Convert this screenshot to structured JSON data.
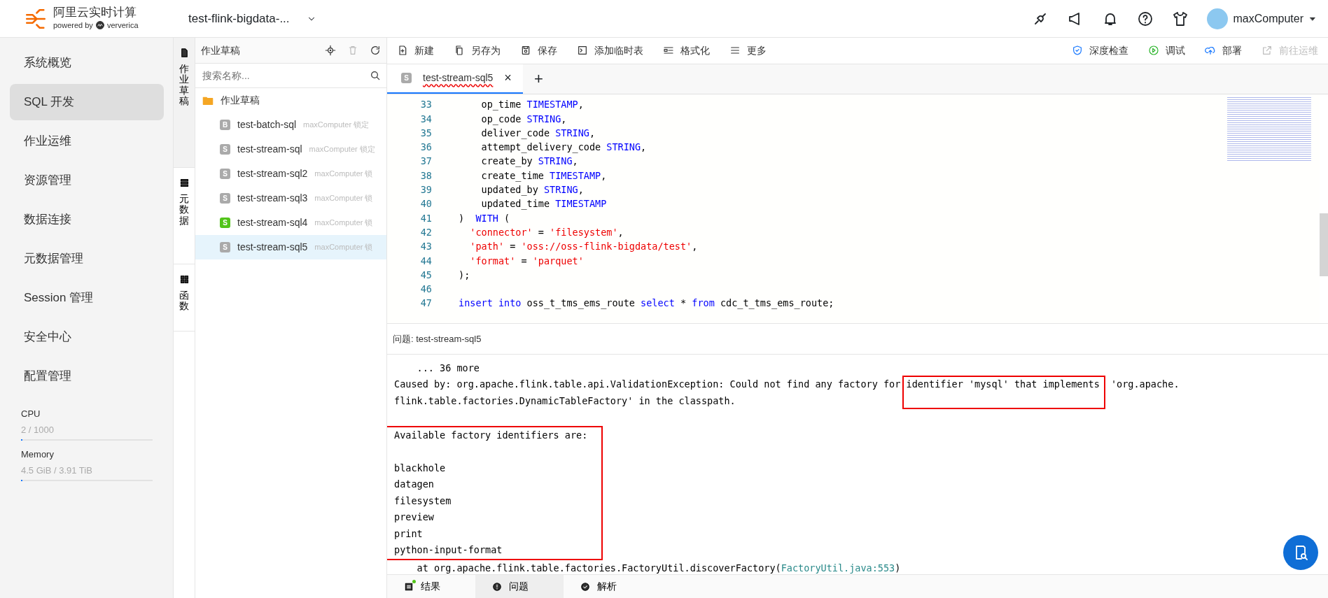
{
  "header": {
    "brand": "阿里云实时计算",
    "powered_by": "powered by",
    "partner": "ververica",
    "workspace": "test-flink-bigdata-...",
    "user": "maxComputer"
  },
  "nav": {
    "items": [
      {
        "label": "系统概览",
        "selected": false
      },
      {
        "label": "SQL 开发",
        "selected": true
      },
      {
        "label": "作业运维",
        "selected": false
      },
      {
        "label": "资源管理",
        "selected": false
      },
      {
        "label": "数据连接",
        "selected": false
      },
      {
        "label": "元数据管理",
        "selected": false
      },
      {
        "label": "Session 管理",
        "selected": false
      },
      {
        "label": "安全中心",
        "selected": false
      },
      {
        "label": "配置管理",
        "selected": false
      }
    ],
    "resources": [
      {
        "name": "CPU",
        "reading": "2 / 1000",
        "level": 0.002
      },
      {
        "name": "Memory",
        "reading": "4.5 GiB / 3.91 TiB",
        "level": 0.001
      }
    ]
  },
  "side_tabs": [
    {
      "label": "作业草稿",
      "kind": "file",
      "selected": true
    },
    {
      "label": "元数据",
      "kind": "db",
      "selected": false
    },
    {
      "label": "函数",
      "kind": "grid",
      "selected": false
    }
  ],
  "tree": {
    "title": "作业草稿",
    "placeholder": "搜索名称...",
    "folder": "作业草稿",
    "items": [
      {
        "badge": "B",
        "label": "test-batch-sql",
        "owner": "maxComputer 锁定",
        "color": "#aaaaaa",
        "selected": false
      },
      {
        "badge": "S",
        "label": "test-stream-sql",
        "owner": "maxComputer 锁定",
        "color": "#aaaaaa",
        "selected": false
      },
      {
        "badge": "S",
        "label": "test-stream-sql2",
        "owner": "maxComputer 锁",
        "color": "#aaaaaa",
        "selected": false
      },
      {
        "badge": "S",
        "label": "test-stream-sql3",
        "owner": "maxComputer 锁",
        "color": "#aaaaaa",
        "selected": false
      },
      {
        "badge": "S",
        "label": "test-stream-sql4",
        "owner": "maxComputer 锁",
        "color": "#52c41a",
        "selected": false
      },
      {
        "badge": "S",
        "label": "test-stream-sql5",
        "owner": "maxComputer 锁",
        "color": "#aaaaaa",
        "selected": true
      }
    ]
  },
  "toolbar": {
    "left": [
      {
        "label": "新建",
        "kind": "new"
      },
      {
        "label": "另存为",
        "kind": "copy"
      },
      {
        "label": "保存",
        "kind": "save"
      },
      {
        "label": "添加临时表",
        "kind": "terminal"
      },
      {
        "label": "格式化",
        "kind": "format"
      },
      {
        "label": "更多",
        "kind": "menu"
      }
    ],
    "right": [
      {
        "label": "深度检查",
        "kind": "shield",
        "disabled": false
      },
      {
        "label": "调试",
        "kind": "play",
        "disabled": false
      },
      {
        "label": "部署",
        "kind": "upload",
        "disabled": false
      },
      {
        "label": "前往运维",
        "kind": "external",
        "disabled": true
      }
    ]
  },
  "editor_tab": {
    "badge": "S",
    "label": "test-stream-sql5",
    "close": "×",
    "add": "+"
  },
  "code": [
    {
      "number": "33",
      "tokens": [
        {
          "text": "    op_time ",
          "kind": "plain"
        },
        {
          "text": "TIMESTAMP",
          "kind": "keyword"
        },
        {
          "text": ",",
          "kind": "plain"
        }
      ]
    },
    {
      "number": "34",
      "tokens": [
        {
          "text": "    op_code ",
          "kind": "plain"
        },
        {
          "text": "STRING",
          "kind": "keyword"
        },
        {
          "text": ",",
          "kind": "plain"
        }
      ]
    },
    {
      "number": "35",
      "tokens": [
        {
          "text": "    deliver_code ",
          "kind": "plain"
        },
        {
          "text": "STRING",
          "kind": "keyword"
        },
        {
          "text": ",",
          "kind": "plain"
        }
      ]
    },
    {
      "number": "36",
      "tokens": [
        {
          "text": "    attempt_delivery_code ",
          "kind": "plain"
        },
        {
          "text": "STRING",
          "kind": "keyword"
        },
        {
          "text": ",",
          "kind": "plain"
        }
      ]
    },
    {
      "number": "37",
      "tokens": [
        {
          "text": "    create_by ",
          "kind": "plain"
        },
        {
          "text": "STRING",
          "kind": "keyword"
        },
        {
          "text": ",",
          "kind": "plain"
        }
      ]
    },
    {
      "number": "38",
      "tokens": [
        {
          "text": "    create_time ",
          "kind": "plain"
        },
        {
          "text": "TIMESTAMP",
          "kind": "keyword"
        },
        {
          "text": ",",
          "kind": "plain"
        }
      ]
    },
    {
      "number": "39",
      "tokens": [
        {
          "text": "    updated_by ",
          "kind": "plain"
        },
        {
          "text": "STRING",
          "kind": "keyword"
        },
        {
          "text": ",",
          "kind": "plain"
        }
      ]
    },
    {
      "number": "40",
      "tokens": [
        {
          "text": "    updated_time ",
          "kind": "plain"
        },
        {
          "text": "TIMESTAMP",
          "kind": "keyword"
        }
      ]
    },
    {
      "number": "41",
      "tokens": [
        {
          "text": ")  ",
          "kind": "plain"
        },
        {
          "text": "WITH",
          "kind": "keyword"
        },
        {
          "text": " (",
          "kind": "plain"
        }
      ]
    },
    {
      "number": "42",
      "tokens": [
        {
          "text": "  'connector'",
          "kind": "string"
        },
        {
          "text": " = ",
          "kind": "plain"
        },
        {
          "text": "'filesystem'",
          "kind": "string"
        },
        {
          "text": ",",
          "kind": "plain"
        }
      ]
    },
    {
      "number": "43",
      "tokens": [
        {
          "text": "  'path'",
          "kind": "string"
        },
        {
          "text": " = ",
          "kind": "plain"
        },
        {
          "text": "'oss://oss-flink-bigdata/test'",
          "kind": "string"
        },
        {
          "text": ",",
          "kind": "plain"
        }
      ]
    },
    {
      "number": "44",
      "tokens": [
        {
          "text": "  'format'",
          "kind": "string"
        },
        {
          "text": " = ",
          "kind": "plain"
        },
        {
          "text": "'parquet'",
          "kind": "string"
        }
      ]
    },
    {
      "number": "45",
      "tokens": [
        {
          "text": ");",
          "kind": "plain"
        }
      ]
    },
    {
      "number": "46"
    },
    {
      "number": "47",
      "tokens": [
        {
          "text": "insert into",
          "kind": "keyword"
        },
        {
          "text": " oss_t_tms_ems_route ",
          "kind": "plain"
        },
        {
          "text": "select",
          "kind": "keyword"
        },
        {
          "text": " * ",
          "kind": "plain"
        },
        {
          "text": "from",
          "kind": "keyword"
        },
        {
          "text": " cdc_t_tms_ems_route;",
          "kind": "plain"
        }
      ]
    }
  ],
  "problems": {
    "title": "问题: test-stream-sql5",
    "log": [
      {
        "text": "    ... 36 more"
      },
      {
        "text": "Caused by: org.apache.flink.table.api.ValidationException: Could not find any factory for ",
        "highlight": "identifier 'mysql' that implements",
        "after": " 'org.apache."
      },
      {
        "text": "flink.table.factories.DynamicTableFactory' in the classpath."
      }
    ],
    "identifiers": {
      "heading": "Available factory identifiers are:",
      "items": [
        "blackhole",
        "datagen",
        "filesystem",
        "preview",
        "print",
        "python-input-format"
      ]
    },
    "trace": [
      {
        "text": "    at org.apache.flink.table.factories.FactoryUtil.discoverFactory(",
        "link": "FactoryUtil.java:553",
        "after": ")"
      }
    ]
  },
  "bottom_tabs": [
    {
      "label": "结果",
      "kind": "list",
      "selected": false,
      "dot": true
    },
    {
      "label": "问题",
      "kind": "alert",
      "selected": true,
      "dot": false
    },
    {
      "label": "解析",
      "kind": "check",
      "selected": false,
      "dot": false
    }
  ]
}
